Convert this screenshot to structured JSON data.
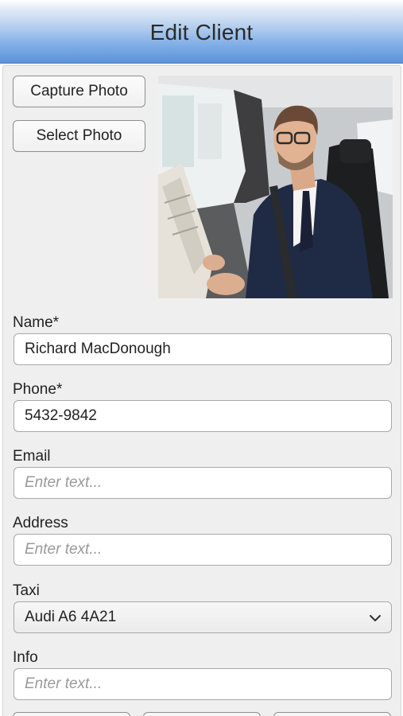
{
  "header": {
    "title": "Edit Client"
  },
  "photo_actions": {
    "capture_label": "Capture Photo",
    "select_label": "Select Photo"
  },
  "form": {
    "name": {
      "label": "Name*",
      "value": "Richard MacDonough"
    },
    "phone": {
      "label": "Phone*",
      "value": "5432-9842"
    },
    "email": {
      "label": "Email",
      "placeholder": "Enter text..."
    },
    "address": {
      "label": "Address",
      "placeholder": "Enter text..."
    },
    "taxi": {
      "label": "Taxi",
      "selected": "Audi A6 4A21"
    },
    "info": {
      "label": "Info",
      "placeholder": "Enter text..."
    }
  },
  "icons": {
    "taxi_dropdown": "chevron-down-icon"
  }
}
